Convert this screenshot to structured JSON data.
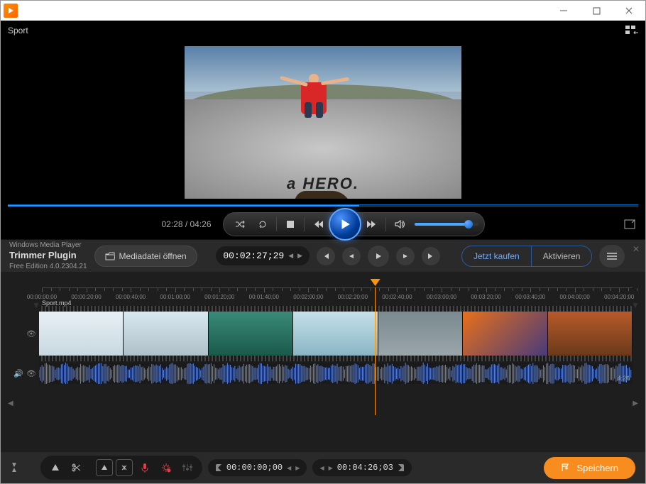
{
  "header": {
    "title": "Sport"
  },
  "player": {
    "time_display": "02:28 / 04:26",
    "progress_pct": 55.7,
    "volume_pct": 80
  },
  "plugin": {
    "parent": "Windows Media Player",
    "name": "Trimmer Plugin",
    "edition": "Free Edition 4.0.2304.21",
    "open_label": "Mediadatei öffnen",
    "timecode": "00:02:27;29",
    "buy_label": "Jetzt kaufen",
    "activate_label": "Aktivieren"
  },
  "video_preview": {
    "hero_text": "a HERO."
  },
  "timeline": {
    "clip_name": "Sport.mp4",
    "duration_label": "4:26",
    "ruler_ticks": [
      "00:00:00;00",
      "00:00:20;00",
      "00:00:40;00",
      "00:01:00;00",
      "00:01:20;00",
      "00:01:40;00",
      "00:02:00;00",
      "00:02:20;00",
      "00:02:40;00",
      "00:03:00;00",
      "00:03:20;00",
      "00:03:40;00",
      "00:04:00;00",
      "00:04:20;00"
    ],
    "playhead_pct": 55.6
  },
  "trim": {
    "in_timecode": "00:00:00;00",
    "out_timecode": "00:04:26;03",
    "save_label": "Speichern"
  }
}
